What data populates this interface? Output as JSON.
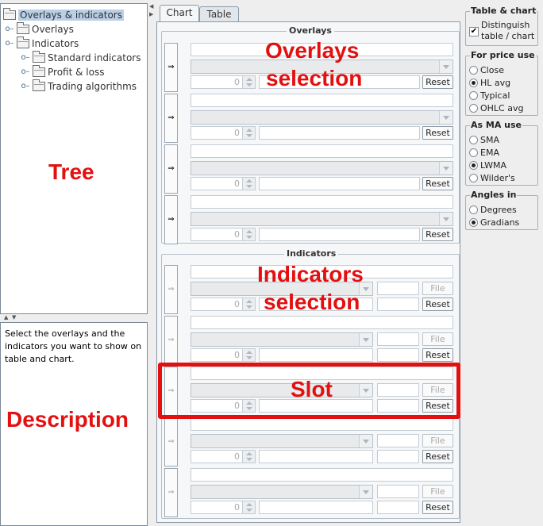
{
  "tree": {
    "root": "Overlays & indicators",
    "nodes": [
      {
        "label": "Overlays",
        "level": 1
      },
      {
        "label": "Indicators",
        "level": 1
      },
      {
        "label": "Standard indicators",
        "level": 2
      },
      {
        "label": "Profit & loss",
        "level": 2
      },
      {
        "label": "Trading algorithms",
        "level": 2
      }
    ]
  },
  "description": "Select the overlays and the indicators you want to show on table and chart.",
  "tabs": [
    "Chart",
    "Table"
  ],
  "overlays": {
    "title": "Overlays",
    "slot_button": "⇒",
    "spin_value": "0",
    "reset_label": "Reset"
  },
  "indicators": {
    "title": "Indicators",
    "slot_button": "⇒",
    "spin_value": "0",
    "file_label": "File",
    "reset_label": "Reset"
  },
  "options": {
    "table_chart": {
      "title": "Table & chart",
      "checkbox_label_line1": "Distinguish",
      "checkbox_label_line2": "table / chart",
      "checked": true
    },
    "price_use": {
      "title": "For price use",
      "options": [
        "Close",
        "HL avg",
        "Typical",
        "OHLC avg"
      ],
      "selected": "HL avg"
    },
    "ma_use": {
      "title": "As MA use",
      "options": [
        "SMA",
        "EMA",
        "LWMA",
        "Wilder's"
      ],
      "selected": "LWMA"
    },
    "angles": {
      "title": "Angles in",
      "options": [
        "Degrees",
        "Gradians"
      ],
      "selected": "Gradians"
    }
  },
  "annotations": {
    "tree": "Tree",
    "description": "Description",
    "overlays_line1": "Overlays",
    "overlays_line2": "selection",
    "indicators_line1": "Indicators",
    "indicators_line2": "selection",
    "slot": "Slot"
  },
  "colors": {
    "annotation_red": "#e41010",
    "tree_selection": "#b8cfe5"
  }
}
